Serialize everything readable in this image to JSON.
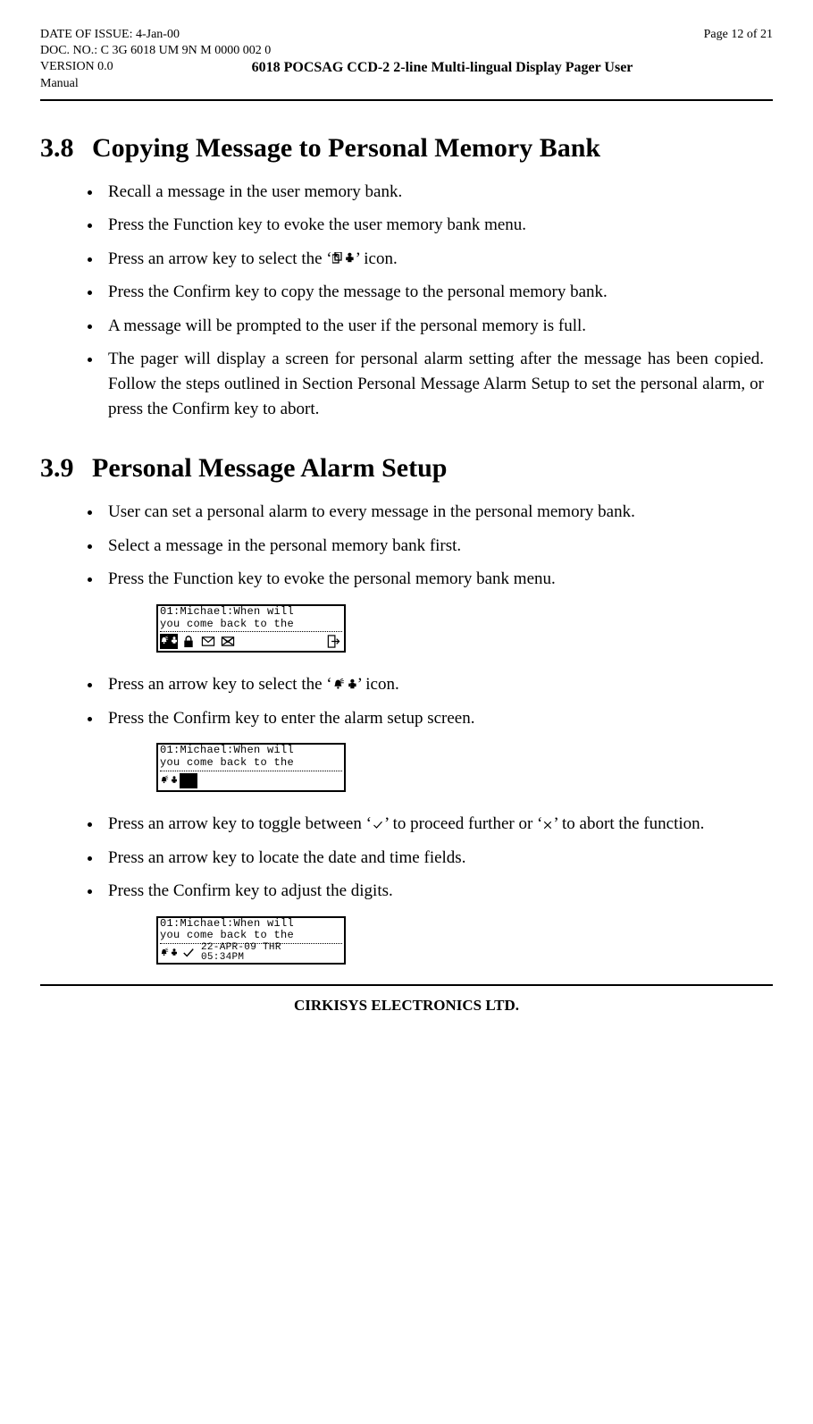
{
  "header": {
    "date_label": "DATE OF ISSUE: 4-Jan-00",
    "doc_no": "DOC. NO.: C 3G 6018 UM 9N M 0000 002 0",
    "version": "VERSION 0.0",
    "manual": "Manual",
    "page": "Page 12 of 21",
    "title": "6018 POCSAG CCD-2 2-line Multi-lingual Display Pager User"
  },
  "sec38": {
    "num": "3.8",
    "title": "Copying Message to Personal Memory Bank",
    "bullets": [
      "Recall a message in the user memory bank.",
      "Press the Function key to evoke the user memory bank menu.",
      {
        "pre": "Press an arrow key to select the ‘",
        "post": "’ icon.",
        "icon": "copy-person-icon"
      },
      "Press the Confirm key to copy the message to the personal memory bank.",
      "A message will be prompted to the user if the personal memory is full.",
      "The pager will display a screen for personal alarm setting after the message has been copied.  Follow the steps outlined in Section Personal Message Alarm Setup to set the personal alarm, or press the Confirm key to abort."
    ]
  },
  "sec39": {
    "num": "3.9",
    "title": "Personal Message Alarm Setup",
    "bulletsA": [
      "User can set a personal alarm to every message in the personal memory bank.",
      "Select a message in the personal memory bank first.",
      "Press the Function key to evoke the personal memory bank menu."
    ],
    "bulletsB": [
      {
        "pre": "Press an arrow key to select the ‘",
        "post": "’ icon.",
        "icon": "alarm-person-icon"
      },
      "Press the Confirm key to enter the alarm setup screen."
    ],
    "bulletsC_pre": "Press an arrow key to toggle between ‘",
    "bulletsC_mid": "’ to proceed further or ‘",
    "bulletsC_post": "’ to abort the function.",
    "bulletsC_rest": [
      "Press an arrow key to locate the date and time fields.",
      "Press the Confirm key to adjust the digits."
    ]
  },
  "lcd": {
    "line1": "01:Michael:When will",
    "line2": "you come back to the",
    "fig3_line1": "  22-APR-09 THR",
    "fig3_line2": "  05:34PM"
  },
  "footer": "CIRKISYS ELECTRONICS LTD."
}
